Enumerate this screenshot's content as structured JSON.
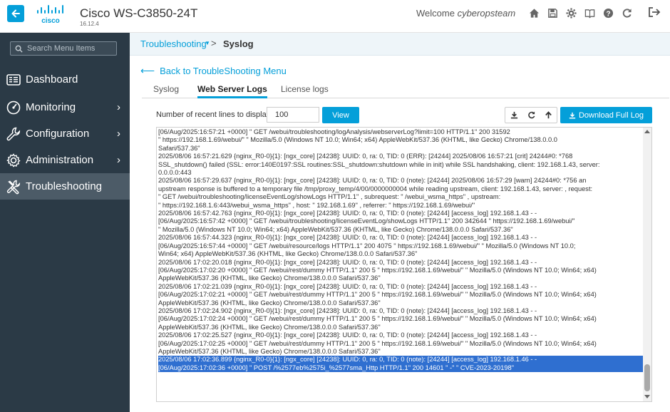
{
  "header": {
    "brand": "cisco",
    "device_title": "Cisco WS-C3850-24T",
    "version": "16.12.4",
    "welcome_prefix": "Welcome",
    "username": "cyberopsteam",
    "icons": [
      "home-icon",
      "save-icon",
      "gear-icon",
      "book-icon",
      "help-icon",
      "refresh-icon",
      "logout-icon"
    ],
    "accent": "#049fd9"
  },
  "sidebar": {
    "search_placeholder": "Search Menu Items",
    "items": [
      {
        "label": "Dashboard",
        "icon": "dashboard-icon",
        "chevron": ""
      },
      {
        "label": "Monitoring",
        "icon": "monitoring-icon",
        "chevron": "›"
      },
      {
        "label": "Configuration",
        "icon": "wrench-icon",
        "chevron": "›"
      },
      {
        "label": "Administration",
        "icon": "gear-icon",
        "chevron": "›"
      },
      {
        "label": "Troubleshooting",
        "icon": "tools-icon",
        "chevron": ""
      }
    ],
    "active_item": "Troubleshooting",
    "background": "#2b3a46"
  },
  "breadcrumb": {
    "parent": "Troubleshooting",
    "separator": ">",
    "current": "Syslog"
  },
  "back_link": "Back to TroubleShooting Menu",
  "tabs": [
    {
      "label": "Syslog",
      "active": false
    },
    {
      "label": "Web Server Logs",
      "active": true
    },
    {
      "label": "License logs",
      "active": false
    }
  ],
  "controls": {
    "lines_label": "Number of recent lines to display",
    "lines_value": "100",
    "view_label": "View",
    "download_label": "Download Full Log",
    "tool_icons": [
      "download-icon",
      "refresh-icon",
      "arrow-up-icon"
    ]
  },
  "log_lines": [
    "[06/Aug/2025:16:57:21 +0000] \" GET /webui/troubleshooting/logAnalysis/webserverLog?limit=100 HTTP/1.1\"  200 31592",
    "\" https://192.168.1.69/webui/\"  \" Mozilla/5.0 (Windows NT 10.0; Win64; x64) AppleWebKit/537.36 (KHTML, like Gecko) Chrome/138.0.0.0",
    "Safari/537.36\"",
    "2025/08/06 16:57:21.629 {nginx_R0-0}{1}: [ngx_core] [24238]: UUID: 0, ra: 0, TID: 0 (ERR): [24244] 2025/08/06 16:57:21 [crit] 24244#0: *768",
    "SSL_shutdown() failed (SSL: error:140E0197:SSL routines:SSL_shutdown:shutdown while in init) while SSL handshaking, client: 192.168.1.43, server:",
    "0.0.0.0:443",
    "2025/08/06 16:57:29.637 {nginx_R0-0}{1}: [ngx_core] [24238]: UUID: 0, ra: 0, TID: 0 (note): [24244] 2025/08/06 16:57:29 [warn] 24244#0: *756 an",
    "upstream response is buffered to a temporary file /tmp/proxy_temp/4/00/0000000004 while reading upstream, client: 192.168.1.43, server: , request:",
    "\" GET /webui/troubleshooting/licenseEventLog/showLogs HTTP/1.1\" , subrequest: \" /webui_wsma_https\" , upstream:",
    "\" https://192.168.1.6:443/webui_wsma_https\" , host: \" 192.168.1.69\" , referrer: \" https://192.168.1.69/webui/\"",
    "2025/08/06 16:57:42.763 {nginx_R0-0}{1}: [ngx_core] [24238]: UUID: 0, ra: 0, TID: 0 (note): [24244] [access_log] 192.168.1.43 - -",
    "[06/Aug/2025:16:57:42 +0000] \" GET /webui/troubleshooting/licenseEventLog/showLogs HTTP/1.1\"  200 342644 \" https://192.168.1.69/webui/\"",
    "\" Mozilla/5.0 (Windows NT 10.0; Win64; x64) AppleWebKit/537.36 (KHTML, like Gecko) Chrome/138.0.0.0 Safari/537.36\"",
    "2025/08/06 16:57:44.323 {nginx_R0-0}{1}: [ngx_core] [24238]: UUID: 0, ra: 0, TID: 0 (note): [24244] [access_log] 192.168.1.43 - -",
    "[06/Aug/2025:16:57:44 +0000] \" GET /webui/resource/logs HTTP/1.1\"  200 4075 \" https://192.168.1.69/webui/\"  \" Mozilla/5.0 (Windows NT 10.0;",
    "Win64; x64) AppleWebKit/537.36 (KHTML, like Gecko) Chrome/138.0.0.0 Safari/537.36\"",
    "2025/08/06 17:02:20.018 {nginx_R0-0}{1}: [ngx_core] [24238]: UUID: 0, ra: 0, TID: 0 (note): [24244] [access_log] 192.168.1.43 - -",
    "[06/Aug/2025:17:02:20 +0000] \" GET /webui/rest/dummy HTTP/1.1\"  200 5 \" https://192.168.1.69/webui/\"  \" Mozilla/5.0 (Windows NT 10.0; Win64; x64)",
    "AppleWebKit/537.36 (KHTML, like Gecko) Chrome/138.0.0.0 Safari/537.36\"",
    "2025/08/06 17:02:21.039 {nginx_R0-0}{1}: [ngx_core] [24238]: UUID: 0, ra: 0, TID: 0 (note): [24244] [access_log] 192.168.1.43 - -",
    "[06/Aug/2025:17:02:21 +0000] \" GET /webui/rest/dummy HTTP/1.1\"  200 5 \" https://192.168.1.69/webui/\"  \" Mozilla/5.0 (Windows NT 10.0; Win64; x64)",
    "AppleWebKit/537.36 (KHTML, like Gecko) Chrome/138.0.0.0 Safari/537.36\"",
    "2025/08/06 17:02:24.902 {nginx_R0-0}{1}: [ngx_core] [24238]: UUID: 0, ra: 0, TID: 0 (note): [24244] [access_log] 192.168.1.43 - -",
    "[06/Aug/2025:17:02:24 +0000] \" GET /webui/rest/dummy HTTP/1.1\"  200 5 \" https://192.168.1.69/webui/\"  \" Mozilla/5.0 (Windows NT 10.0; Win64; x64)",
    "AppleWebKit/537.36 (KHTML, like Gecko) Chrome/138.0.0.0 Safari/537.36\"",
    "2025/08/06 17:02:25.527 {nginx_R0-0}{1}: [ngx_core] [24238]: UUID: 0, ra: 0, TID: 0 (note): [24244] [access_log] 192.168.1.43 - -",
    "[06/Aug/2025:17:02:25 +0000] \" GET /webui/rest/dummy HTTP/1.1\"  200 5 \" https://192.168.1.69/webui/\"  \" Mozilla/5.0 (Windows NT 10.0; Win64; x64)",
    "AppleWebKit/537.36 (KHTML, like Gecko) Chrome/138.0.0.0 Safari/537.36\""
  ],
  "selected_log_lines": [
    "2025/08/06 17:02:36.899 {nginx_R0-0}{1}: [ngx_core] [24238]: UUID: 0, ra: 0, TID: 0 (note): [24244] [access_log] 192.168.1.46 - -",
    "[06/Aug/2025:17:02:36 +0000] \" POST /%2577eb%2575i_%2577sma_Http HTTP/1.1\"  200 14601 \" -\"  \" CVE-2023-20198\""
  ],
  "selection_color": "#2f6fd0"
}
